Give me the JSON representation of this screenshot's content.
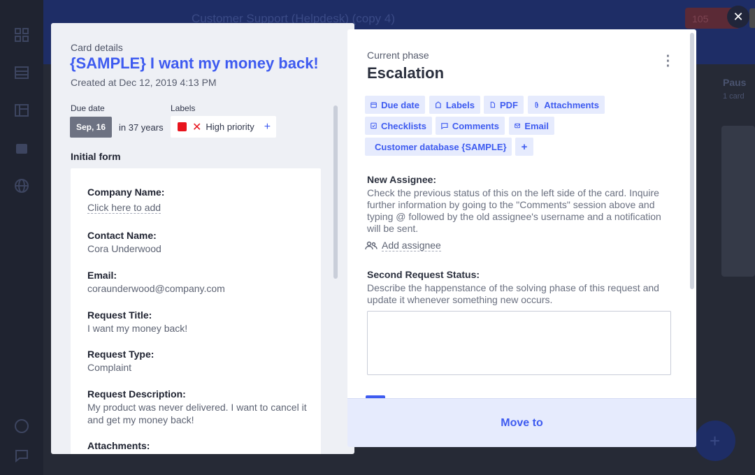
{
  "background": {
    "app_title": "Customer Support (Helpdesk) (copy 4)",
    "notification_count": "105",
    "column_title": "Paus",
    "column_subtitle": "1 card"
  },
  "left": {
    "section_label": "Card details",
    "title": "{SAMPLE} I want my money back!",
    "created": "Created at Dec 12, 2019 4:13 PM",
    "due_label": "Due date",
    "due_value": "Sep, 16",
    "due_relative": "in 37 years",
    "labels_label": "Labels",
    "label_name": "High priority",
    "label_color": "#e8141d",
    "label_add": "+",
    "form_heading": "Initial form",
    "fields": [
      {
        "label": "Company Name:",
        "value": "Click here to add",
        "is_link": true
      },
      {
        "label": "Contact Name:",
        "value": "Cora Underwood"
      },
      {
        "label": "Email:",
        "value": "coraunderwood@company.com"
      },
      {
        "label": "Request Title:",
        "value": "I want my money back!"
      },
      {
        "label": "Request Type:",
        "value": "Complaint"
      },
      {
        "label": "Request Description:",
        "value": "My product was never delivered. I want to cancel it and get my money back!"
      },
      {
        "label": "Attachments:",
        "value": ""
      }
    ]
  },
  "right": {
    "section_label": "Current phase",
    "phase_title": "Escalation",
    "chips": {
      "due_date": "Due date",
      "labels": "Labels",
      "pdf": "PDF",
      "attachments": "Attachments",
      "checklists": "Checklists",
      "comments": "Comments",
      "email": "Email",
      "database": "Customer database {SAMPLE}",
      "add": "+"
    },
    "assignee_label": "New Assignee:",
    "assignee_desc": "Check the previous status of this on the left side of the card. Inquire further information by going to the \"Comments\" session above and typing @ followed by the old assignee's username and a notification will be sent.",
    "add_assignee": "Add assignee",
    "status_label": "Second Request Status:",
    "status_desc": "Describe the happenstance of the solving phase of this request and update it whenever something new occurs.",
    "status_value": "",
    "move_to": "Move to"
  },
  "accent_color": "#3e5bf0"
}
